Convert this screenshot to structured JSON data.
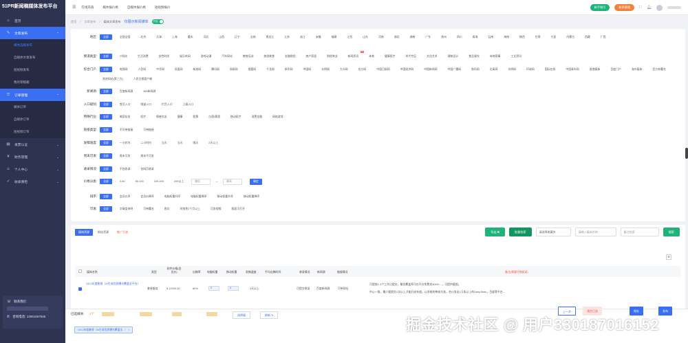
{
  "app": {
    "logo": "51PR新闻稿媒体发布平台"
  },
  "sidebar": {
    "items": [
      {
        "label": "首页",
        "icon": "⌂"
      },
      {
        "label": "文章发布",
        "icon": "✎"
      },
      {
        "label": "媒体选稿发布"
      },
      {
        "label": "自媒体文章发布"
      },
      {
        "label": "短视频发布"
      },
      {
        "label": "我的草稿箱"
      },
      {
        "label": "订单管理",
        "icon": "☰"
      },
      {
        "label": "媒体订单"
      },
      {
        "label": "自媒体订单"
      },
      {
        "label": "短视频订单"
      },
      {
        "label": "发票认证",
        "icon": "▤"
      },
      {
        "label": "财务管理",
        "icon": "¥"
      },
      {
        "label": "个人中心",
        "icon": "☺"
      },
      {
        "label": "收录质检",
        "icon": "✓"
      }
    ],
    "contact": {
      "title": "联系我们",
      "phone": "咨询电话: 13061657545"
    }
  },
  "topbar": {
    "nav": [
      "在线充值",
      "媒体报价格",
      "自媒体报价格",
      "短视频报价"
    ],
    "newbie": "新手指引",
    "service": "联系客服"
  },
  "breadcrumb": {
    "items": [
      "首页",
      "文章发布",
      "媒体文章发布"
    ],
    "page_title": "仅展示新闻媒体",
    "toggle": "开启"
  },
  "filters": [
    {
      "label": "地区:",
      "options": [
        "全部",
        "全国全国",
        "北京",
        "天津",
        "上海",
        "重庆",
        "河北",
        "山西",
        "辽宁",
        "吉林",
        "黑龙江",
        "江苏",
        "浙江",
        "安徽",
        "福建",
        "江西",
        "山东",
        "河南",
        "湖北",
        "湖南",
        "广东",
        "贵州",
        "四川",
        "青海",
        "云南",
        "海南",
        "陕西",
        "甘肃",
        "宁夏",
        "内蒙古",
        "西藏",
        "广西"
      ]
    },
    {
      "label": "频道类型:",
      "options": [
        "全部",
        "IT科技",
        "生活消费",
        "女性时尚",
        "娱乐休闲",
        "游戏动漫",
        "汽车网站",
        "教育培训",
        "旅游美食",
        "金融财经",
        "房产家居",
        "财经商业",
        "新闻资讯",
        "体育",
        "健康医疗",
        "时代专区",
        "文化艺术",
        "建筑设计",
        "食品餐饮",
        "体育赛事",
        "工业资讯"
      ]
    },
    {
      "label": "综合门户:",
      "options": [
        "全部",
        "央视网",
        "人民网",
        "中华网",
        "凤凰网",
        "新浪网",
        "腾讯网",
        "网易网",
        "搜狐网",
        "千龙网",
        "新华网",
        "中国网",
        "光明网",
        "大众网",
        "东方网",
        "中国日报网",
        "中国经济网",
        "中国新闻网",
        "中国广播网",
        "和讯网",
        "北青网",
        "光明网",
        "环球网",
        "国际在线",
        "中国青年网",
        "香港媒体",
        "百度门户",
        "海外媒体",
        "官方有署名",
        "其他网站(第三方)",
        "人民日报客户端"
      ]
    },
    {
      "label": "新闻源:",
      "options": [
        "全部",
        "百度新闻源",
        "360新闻源"
      ]
    },
    {
      "label": "入口级别:",
      "options": [
        "全部",
        "首页入口",
        "频道入口",
        "栏目入口",
        "上级入口"
      ]
    },
    {
      "label": "特殊行业:",
      "options": [
        "全部",
        "美容化妆",
        "医疗",
        "情感交友",
        "健康",
        "股票",
        "白酒/黄酒",
        "移动医疗",
        "消费金融",
        "网络游戏"
      ]
    },
    {
      "label": "链接类型:",
      "options": [
        "全部",
        "不可带链接",
        "可带链接"
      ]
    },
    {
      "label": "发稿速度:",
      "options": [
        "全部",
        "一小时内",
        "二小时内",
        "当天",
        "当天",
        "隔天",
        "2天以上"
      ]
    },
    {
      "label": "周末可发:",
      "options": [
        "全部",
        "周末可发",
        "周末不可发"
      ]
    },
    {
      "label": "收录情况:",
      "options": [
        "全部",
        "不包收录",
        "包网页收录"
      ]
    },
    {
      "label": "价格分类:",
      "options": [
        "全部",
        "0-50",
        "50-100",
        "100-200",
        "200以上"
      ]
    },
    {
      "label": "排序:",
      "options": [
        "全部",
        "会员价序",
        "会员价降序",
        "电脑权重升序",
        "电脑权重降序",
        "移动权重升序",
        "移动权重降序"
      ]
    },
    {
      "label": "可发:",
      "options": [
        "全部",
        "文章类申明",
        "可带署名",
        "图文",
        "时效性2个月以上",
        "可发视频",
        "版面可打开"
      ]
    }
  ],
  "price_range": {
    "min_placeholder": "最低",
    "max_placeholder": "最高",
    "sep": "—",
    "confirm": "确定"
  },
  "hot_badge": "hot",
  "table": {
    "tabs": [
      "媒体资源",
      "粉丝资源",
      "推广引流"
    ],
    "export": "导出",
    "bulk": "批量检索",
    "select_placeholder": "请选择收藏夹",
    "search_placeholder": "请输入媒体名称",
    "remark_placeholder": "备注检索",
    "search_btn": "搜索",
    "settings_icon": "⚙",
    "headers": [
      "媒体名称",
      "类型",
      "软件价格(会员价)",
      "出稿率",
      "电脑权重",
      "移动权重",
      "发稿速度",
      "平均出稿时间",
      "收录情况",
      "新闻源",
      "链接情况",
      "备注(需要仔细阅读)"
    ],
    "row": {
      "name": "GEO年度套餐（AI生成优质曝光覆盖全平台）",
      "type": "套餐服务",
      "price": "¥ 12000.00",
      "rate": "80%",
      "pc_weight": "5",
      "mobile_weight": "5",
      "speed": "2天以上",
      "avg_time": "",
      "index": "可提交收录",
      "source": "百度新闻源",
      "link": "可带网址",
      "remark1": "可提前1-3个工作日提交，最优覆盖率可在平台免费发4000+...，可提供截图。",
      "remark2": "中心一角，最少要提交1次以上才能开启年度，以系统的审核为准，合计发出1万条以上的DeepSeek，百度等平台..."
    }
  },
  "bottom": {
    "selected_label": "已选媒体:",
    "selected_count": "1个",
    "choose_btn": "选择媒",
    "refresh_btn": "刷新",
    "tag": "GEO年度套餐（AI生成优质曝光覆盖全...）",
    "prev_btn": "上一步",
    "clear_btn": "清空已选",
    "save_btn": "保存",
    "publish_btn": "发布",
    "watermark": "掘金技术社区 @ 用户330187016152"
  }
}
